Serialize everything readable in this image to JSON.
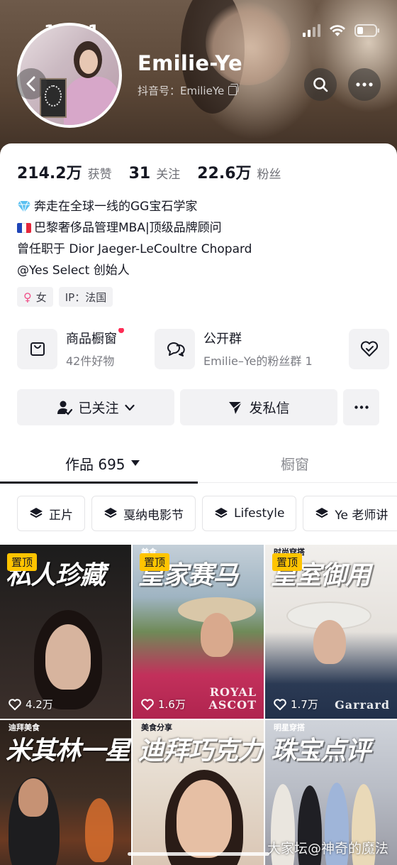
{
  "status_bar": {
    "time": "16:01"
  },
  "profile": {
    "name": "Emilie-Ye",
    "douyin_id_label": "抖音号：EmilieYe"
  },
  "stats": [
    {
      "value": "214.2万",
      "label": "获赞"
    },
    {
      "value": "31",
      "label": "关注"
    },
    {
      "value": "22.6万",
      "label": "粉丝"
    }
  ],
  "bio": {
    "line1": "奔走在全球一线的GG宝石学家",
    "line2": "巴黎奢侈品管理MBA|顶级品牌顾问",
    "line3": "曾任职于 Dior Jaeger-LeCoultre Chopard",
    "line4": "@Yes Select 创始人"
  },
  "tags": {
    "gender": "女",
    "ip": "IP：法国"
  },
  "cards": {
    "shop": {
      "title": "商品橱窗",
      "sub": "42件好物"
    },
    "group": {
      "title": "公开群",
      "sub": "Emilie–Ye的粉丝群 1"
    }
  },
  "actions": {
    "follow": "已关注",
    "message": "发私信"
  },
  "tabs": {
    "works": "作品 695",
    "window": "橱窗"
  },
  "collections": [
    "正片",
    "戛纳电影节",
    "Lifestyle",
    "Ye 老师讲"
  ],
  "videos": [
    {
      "kicker": "",
      "title": "私人珍藏",
      "pinned": "置顶",
      "likes": "4.2万",
      "brand": ""
    },
    {
      "kicker": "美食",
      "title": "皇家赛马",
      "pinned": "置顶",
      "likes": "1.6万",
      "brand": "ROYAL ASCOT"
    },
    {
      "kicker": "时尚穿搭",
      "title": "皇室御用",
      "pinned": "置顶",
      "likes": "1.7万",
      "brand": "Garrard"
    },
    {
      "kicker": "迪拜美食",
      "title": "米其林一星",
      "pinned": "",
      "likes": "",
      "brand": ""
    },
    {
      "kicker": "美食分享",
      "title": "迪拜巧克力",
      "pinned": "",
      "likes": "",
      "brand": ""
    },
    {
      "kicker": "明星穿搭",
      "title": "珠宝点评",
      "pinned": "",
      "likes": "",
      "brand": ""
    }
  ],
  "watermark": "大家坛@神奇的魔法",
  "colors": {
    "accent_red": "#fe2c55",
    "pin_yellow": "#ffc400",
    "text": "#161823"
  }
}
